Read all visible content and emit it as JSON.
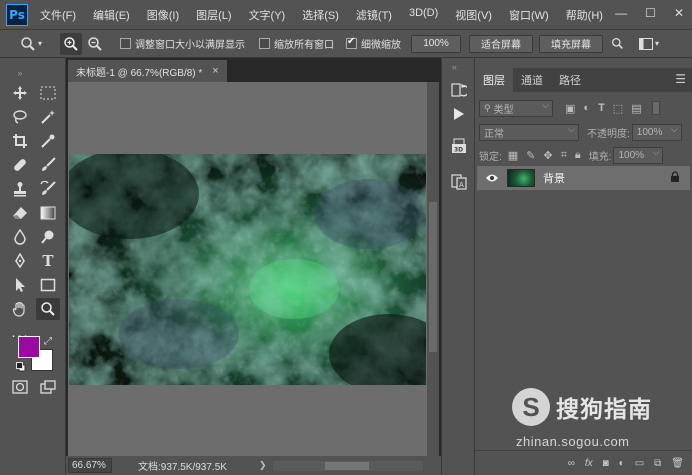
{
  "app": {
    "logo": "Ps"
  },
  "menu": [
    "文件(F)",
    "编辑(E)",
    "图像(I)",
    "图层(L)",
    "文字(Y)",
    "选择(S)",
    "滤镜(T)",
    "3D(D)",
    "视图(V)",
    "窗口(W)",
    "帮助(H)"
  ],
  "window_controls": {
    "minimize": "—",
    "maximize": "☐",
    "close": "✕"
  },
  "options": {
    "resize_windows_label": "调整窗口大小以满屏显示",
    "resize_windows_checked": false,
    "zoom_all_label": "缩放所有窗口",
    "zoom_all_checked": false,
    "scrubby_label": "细微缩放",
    "scrubby_checked": true,
    "zoom_value": "100%",
    "fit_screen": "适合屏幕",
    "fill_screen": "填充屏幕"
  },
  "document": {
    "tab_title": "未标题-1 @ 66.7%(RGB/8) *",
    "tab_close": "×",
    "zoom_level": "66.67%",
    "doc_info": "文档:937.5K/937.5K"
  },
  "colors": {
    "foreground": "#9b0aa0",
    "background": "#ffffff",
    "accent": "#31a8ff"
  },
  "layers_panel": {
    "tabs": [
      "图层",
      "通道",
      "路径"
    ],
    "active_tab": 0,
    "filter_kind": "类型",
    "blend_mode": "正常",
    "opacity_label": "不透明度:",
    "opacity_value": "100%",
    "lock_label": "锁定:",
    "fill_label": "填充:",
    "fill_value": "100%",
    "layers": [
      {
        "name": "背景",
        "visible": true,
        "locked": true
      }
    ]
  },
  "watermark": {
    "text": "搜狗指南",
    "url": "zhinan.sogou.com",
    "logo_letter": "S"
  }
}
